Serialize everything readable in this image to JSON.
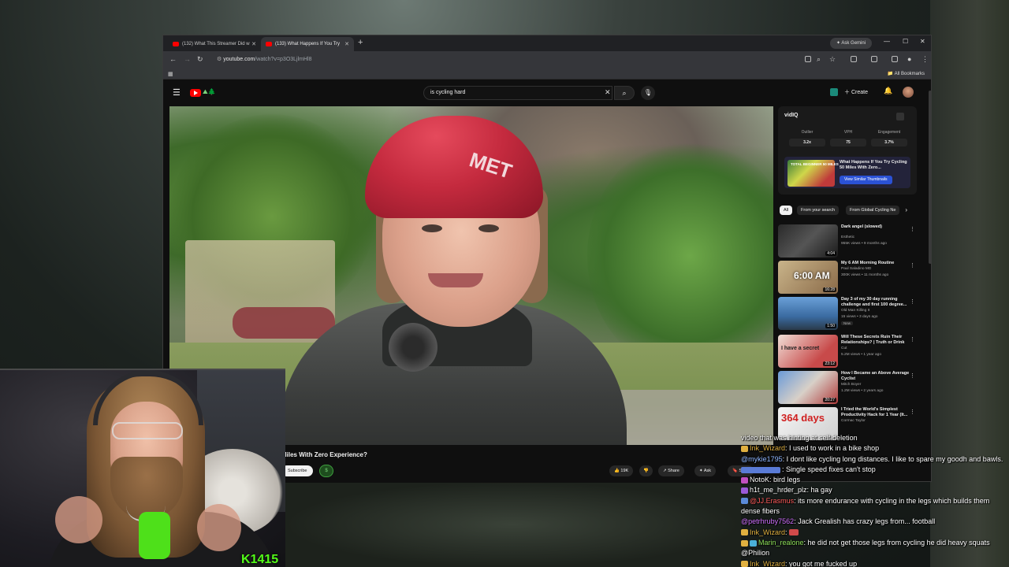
{
  "browser": {
    "tabs": [
      {
        "label": "(132) What This Streamer Did w"
      },
      {
        "label": "(133) What Happens If You Try"
      }
    ],
    "gemini_label": "Ask Gemini",
    "url_host": "youtube.com",
    "url_path": "/watch?v=p3O3LjlmHl8",
    "all_bookmarks": "All Bookmarks"
  },
  "youtube": {
    "search_value": "is cycling hard",
    "create_label": "Create",
    "video_title": "Miles With Zero Experience?",
    "subscribe_label": "Subscribe",
    "money_label": "$",
    "like_count": "19K",
    "share_label": "Share",
    "ask_label": "Ask",
    "save_label": "Save",
    "helmet_text": "MET"
  },
  "vidiq": {
    "logo": "vidIQ",
    "stats": [
      {
        "label": "Outlier",
        "value": "3.2x"
      },
      {
        "label": "VPH",
        "value": "75"
      },
      {
        "label": "Engagement",
        "value": "3.7%"
      }
    ],
    "card_title": "What Happens If You Try Cycling 50 Miles With Zero...",
    "thumb_text": "TOTAL BEGINNER 50 MILES",
    "card_button": "View Similar Thumbnails"
  },
  "chips": [
    {
      "label": "All"
    },
    {
      "label": "From your search"
    },
    {
      "label": "From Global Cycling Ne"
    }
  ],
  "recommendations": [
    {
      "title": "Dark angel (slowed)",
      "channel": "Esthetic",
      "meta": "955K views • 9 months ago",
      "duration": "4:04"
    },
    {
      "title": "My 6 AM Morning Routine",
      "channel": "Paul Saladino MD",
      "meta": "300K views • 11 months ago",
      "duration": "16:28",
      "thumb_text": "6:00 AM"
    },
    {
      "title": "Day 3 of my 30 day running challenge and first 100 degree...",
      "channel": "Old Man Killing It",
      "meta": "15 views • 3 days ago",
      "duration": "1:50",
      "badge": "New"
    },
    {
      "title": "Will These Secrets Ruin Their Relationships? | Truth or Drink",
      "channel": "Cut",
      "meta": "5.2M views • 1 year ago",
      "duration": "23:12",
      "thumb_text": "I have a secret"
    },
    {
      "title": "How I Became an Above Average Cyclist",
      "channel": "Mitch Boyer",
      "meta": "1.2M views • 2 years ago",
      "duration": "20:27"
    },
    {
      "title": "I Tried the World's Simplest Productivity Hack for 1 Year (It...",
      "channel": "Cormac Taylor",
      "meta": "",
      "duration": "",
      "thumb_text": "364 days"
    }
  ],
  "stream": {
    "kick_count": "1415"
  },
  "chat": [
    {
      "user": "",
      "text": "video that was hinting at self-deletion",
      "color": "#ffffff"
    },
    {
      "user": "Ink_Wizard",
      "text": ": I used to work in a bike shop",
      "color": "#e0b040"
    },
    {
      "user": "@mykie1795",
      "text": ": I dont like cycling long distances. I like to spare my goodh and bawls.",
      "color": "#8fb6ff"
    },
    {
      "user": "",
      "text": ": Single speed fixes can't stop",
      "color": "#5a7bd6"
    },
    {
      "user": "NotoK",
      "text": ": bird legs",
      "color": "#ffffff"
    },
    {
      "user": "h1t_me_hrder_plz",
      "text": ": ha gay",
      "color": "#ffffff"
    },
    {
      "user": "@JJ.Erasmus",
      "text": ": its more endurance with cycling in the legs which builds them dense fibers",
      "color": "#ff5b5b"
    },
    {
      "user": "@petrhruby7562",
      "text": ": Jack Grealish has crazy legs from... football",
      "color": "#d070ff"
    },
    {
      "user": "Ink_Wizard",
      "text": ":",
      "color": "#e0b040"
    },
    {
      "user": "Marin_realone",
      "text": ": he did not get those legs from cycling he did heavy squats",
      "color": "#8ee05a"
    },
    {
      "user": "@Philion",
      "text": "",
      "color": "#ffffff"
    },
    {
      "user": "Ink_Wizard",
      "text": ": you got me fucked up",
      "color": "#e0b040"
    }
  ]
}
